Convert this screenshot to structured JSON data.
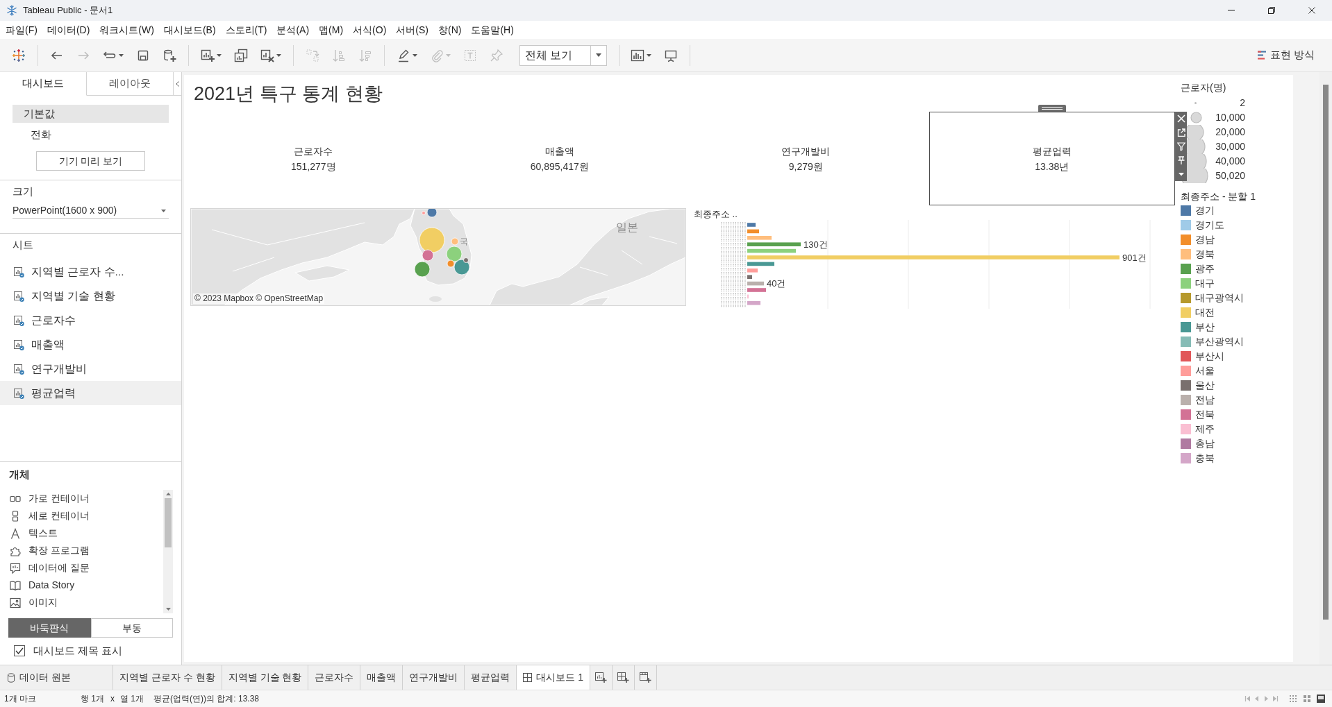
{
  "window": {
    "title": "Tableau Public - 문서1"
  },
  "menu": [
    "파일(F)",
    "데이터(D)",
    "워크시트(W)",
    "대시보드(B)",
    "스토리(T)",
    "분석(A)",
    "맵(M)",
    "서식(O)",
    "서버(S)",
    "창(N)",
    "도움말(H)"
  ],
  "toolbar": {
    "groups": [
      [
        {
          "kind": "logo",
          "disabled": false,
          "dropdown": false
        }
      ],
      [
        {
          "kind": "undo",
          "disabled": false,
          "dropdown": false
        },
        {
          "kind": "redo",
          "disabled": true,
          "dropdown": false
        },
        {
          "kind": "loop",
          "disabled": false,
          "dropdown": true
        },
        {
          "kind": "save",
          "disabled": false,
          "dropdown": false
        },
        {
          "kind": "new_data_source",
          "disabled": false,
          "dropdown": false
        }
      ],
      [
        {
          "kind": "new_sheet",
          "disabled": false,
          "dropdown": true
        },
        {
          "kind": "duplicate_sheet",
          "disabled": false,
          "dropdown": false
        },
        {
          "kind": "clear_sheet",
          "disabled": false,
          "dropdown": true
        }
      ],
      [
        {
          "kind": "swap",
          "disabled": true,
          "dropdown": false
        },
        {
          "kind": "sort_ascending",
          "disabled": true,
          "dropdown": false
        },
        {
          "kind": "sort_descending",
          "disabled": true,
          "dropdown": false
        }
      ],
      [
        {
          "kind": "highlight",
          "disabled": false,
          "dropdown": true
        },
        {
          "kind": "attach",
          "disabled": true,
          "dropdown": true
        },
        {
          "kind": "label",
          "disabled": true,
          "dropdown": false
        },
        {
          "kind": "pin",
          "disabled": true,
          "dropdown": false
        }
      ]
    ],
    "fit_menu": "전체 보기",
    "end_tools": [
      {
        "kind": "show_me_chart",
        "disabled": false,
        "dropdown": true
      },
      {
        "kind": "presentation",
        "disabled": false,
        "dropdown": false
      }
    ],
    "show_me": "표현 방식"
  },
  "left_panel": {
    "tabs": [
      {
        "label": "대시보드",
        "selected": true
      },
      {
        "label": "레이아웃",
        "selected": false
      }
    ],
    "devices": [
      {
        "label": "기본값",
        "selected": true,
        "children": [
          {
            "label": "전화",
            "selected": false
          }
        ]
      }
    ],
    "device_preview_button": "기기 미리 보기",
    "size": {
      "heading": "크기",
      "value": "PowerPoint(1600 x 900)"
    },
    "sheets": {
      "heading": "시트",
      "items": [
        {
          "label": "지역별 근로자 수...",
          "selected": false
        },
        {
          "label": "지역별 기술 현황",
          "selected": false
        },
        {
          "label": "근로자수",
          "selected": false
        },
        {
          "label": "매출액",
          "selected": false
        },
        {
          "label": "연구개발비",
          "selected": false
        },
        {
          "label": "평균업력",
          "selected": true
        }
      ]
    },
    "objects": {
      "heading": "개체",
      "items": [
        {
          "kind": "horizontal_container",
          "label": "가로 컨테이너"
        },
        {
          "kind": "vertical_container",
          "label": "세로 컨테이너"
        },
        {
          "kind": "text",
          "label": "텍스트"
        },
        {
          "kind": "extension",
          "label": "확장 프로그램"
        },
        {
          "kind": "ask_data",
          "label": "데이터에 질문"
        },
        {
          "kind": "data_story",
          "label": "Data Story"
        },
        {
          "kind": "image",
          "label": "이미지"
        }
      ]
    },
    "layout_mode": [
      {
        "label": "바둑판식",
        "selected": true
      },
      {
        "label": "부동",
        "selected": false
      }
    ],
    "show_title": {
      "label": "대시보드 제목 표시",
      "checked": true
    }
  },
  "dashboard": {
    "title": "2021년 특구 통계 현황",
    "kpis": [
      {
        "label": "근로자수",
        "value": "151,277명",
        "selected": false
      },
      {
        "label": "매출액",
        "value": "60,895,417원",
        "selected": false
      },
      {
        "label": "연구개발비",
        "value": "9,279원",
        "selected": false
      },
      {
        "label": "평균업력",
        "value": "13.38년",
        "selected": true
      }
    ],
    "map": {
      "labels": [
        "국",
        "일본"
      ],
      "attribution": "© 2023 Mapbox © OpenStreetMap",
      "marks": [
        {
          "color": "#4e79a7"
        },
        {
          "color": "#ff9d9a"
        },
        {
          "color": "#f1ce63"
        },
        {
          "color": "#ffbe7d"
        },
        {
          "color": "#8cd17d"
        },
        {
          "color": "#d37295"
        },
        {
          "color": "#59a14f"
        },
        {
          "color": "#f28e2b"
        },
        {
          "color": "#499894"
        },
        {
          "color": "#79706e"
        }
      ]
    },
    "bar_chart": {
      "header": "최종주소 ..",
      "bars": [
        {
          "color": "#4e79a7"
        },
        {
          "color": "#f28e2b"
        },
        {
          "color": "#ffbe7d"
        },
        {
          "color": "#59a14f",
          "label": "130건"
        },
        {
          "color": "#8cd17d"
        },
        {
          "color": "#f1ce63",
          "label": "901건"
        },
        {
          "color": "#499894"
        },
        {
          "color": "#ff9d9a"
        },
        {
          "color": "#79706e"
        },
        {
          "color": "#bab0ac",
          "label": "40건"
        },
        {
          "color": "#d37295"
        },
        {
          "color": "#fabfd2"
        },
        {
          "color": "#d4a6c8"
        }
      ]
    },
    "size_legend": {
      "title": "근로자(명)",
      "items": [
        "2",
        "10,000",
        "20,000",
        "30,000",
        "40,000",
        "50,020"
      ]
    },
    "color_legend": {
      "title": "최종주소 - 분할 1",
      "items": [
        {
          "label": "경기",
          "color": "#4e79a7"
        },
        {
          "label": "경기도",
          "color": "#a0cbe8"
        },
        {
          "label": "경남",
          "color": "#f28e2b"
        },
        {
          "label": "경북",
          "color": "#ffbe7d"
        },
        {
          "label": "광주",
          "color": "#59a14f"
        },
        {
          "label": "대구",
          "color": "#8cd17d"
        },
        {
          "label": "대구광역시",
          "color": "#b6992d"
        },
        {
          "label": "대전",
          "color": "#f1ce63"
        },
        {
          "label": "부산",
          "color": "#499894"
        },
        {
          "label": "부산광역시",
          "color": "#86bcb6"
        },
        {
          "label": "부산시",
          "color": "#e15759"
        },
        {
          "label": "서울",
          "color": "#ff9d9a"
        },
        {
          "label": "울산",
          "color": "#79706e"
        },
        {
          "label": "전남",
          "color": "#bab0ac"
        },
        {
          "label": "전북",
          "color": "#d37295"
        },
        {
          "label": "제주",
          "color": "#fabfd2"
        },
        {
          "label": "충남",
          "color": "#b07aa1"
        },
        {
          "label": "충북",
          "color": "#d4a6c8"
        }
      ]
    }
  },
  "sheet_tabs": [
    {
      "kind": "data_source",
      "label": "데이터 원본",
      "selected": false
    },
    {
      "kind": "worksheet",
      "label": "지역별 근로자 수 현황",
      "selected": false
    },
    {
      "kind": "worksheet",
      "label": "지역별 기술 현황",
      "selected": false
    },
    {
      "kind": "worksheet",
      "label": "근로자수",
      "selected": false
    },
    {
      "kind": "worksheet",
      "label": "매출액",
      "selected": false
    },
    {
      "kind": "worksheet",
      "label": "연구개발비",
      "selected": false
    },
    {
      "kind": "worksheet",
      "label": "평균업력",
      "selected": false
    },
    {
      "kind": "dashboard",
      "label": "대시보드 1",
      "selected": true
    }
  ],
  "new_tab_buttons": [
    {
      "kind": "worksheet"
    },
    {
      "kind": "dashboard"
    },
    {
      "kind": "story"
    }
  ],
  "status_bar": {
    "marks": "1개 마크",
    "rows": "행 1개",
    "separator": "x",
    "columns": "열 1개",
    "summary": "평균(업력(연))의 합계: 13.38"
  }
}
